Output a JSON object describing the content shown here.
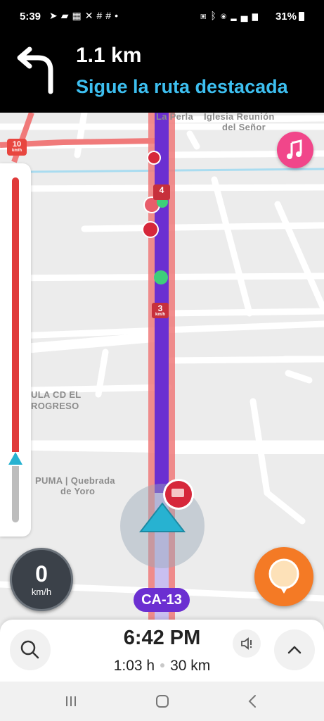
{
  "status_bar": {
    "time": "5:39",
    "left_icons": [
      "telegram-icon",
      "chat-icon",
      "calendar-icon",
      "x-icon",
      "grid-icon",
      "grid-icon",
      "dot-icon"
    ],
    "right_icons": [
      "nfc-icon",
      "bluetooth-icon",
      "location-icon",
      "signal-icon"
    ],
    "battery": "31%"
  },
  "navigation": {
    "distance": "1.1 km",
    "instruction": "Sigue la ruta destacada",
    "turn_icon": "turn-left-arrow-icon",
    "instruction_color": "#3dbff0"
  },
  "map": {
    "labels": {
      "la_perla": "La Perla",
      "iglesia_line1": "Iglesia Reunión",
      "iglesia_line2": "del Señor",
      "cd_line1": "ULA CD EL",
      "cd_line2": "ROGRESO",
      "puma_line1": "PUMA | Quebrada",
      "puma_line2": "de Yoro"
    },
    "route_color": "#6b2fd1",
    "traffic_color": "#e03a3a",
    "speed_sign": {
      "value": "10",
      "unit": "km/h"
    },
    "route_sign_4": {
      "value": "4"
    },
    "route_sign_3": {
      "value": "3",
      "unit": "km/h"
    },
    "road_name": "CA-13"
  },
  "speedometer": {
    "value": "0",
    "unit": "km/h"
  },
  "trip": {
    "eta": "6:42 PM",
    "duration": "1:03 h",
    "distance": "30 km"
  },
  "buttons": {
    "music": "music-note-icon",
    "report": "report-pin-icon",
    "search": "search-icon",
    "sound": "speaker-alert-icon",
    "expand": "chevron-up-icon"
  },
  "android_nav": [
    "recents-icon",
    "home-icon",
    "back-icon"
  ]
}
